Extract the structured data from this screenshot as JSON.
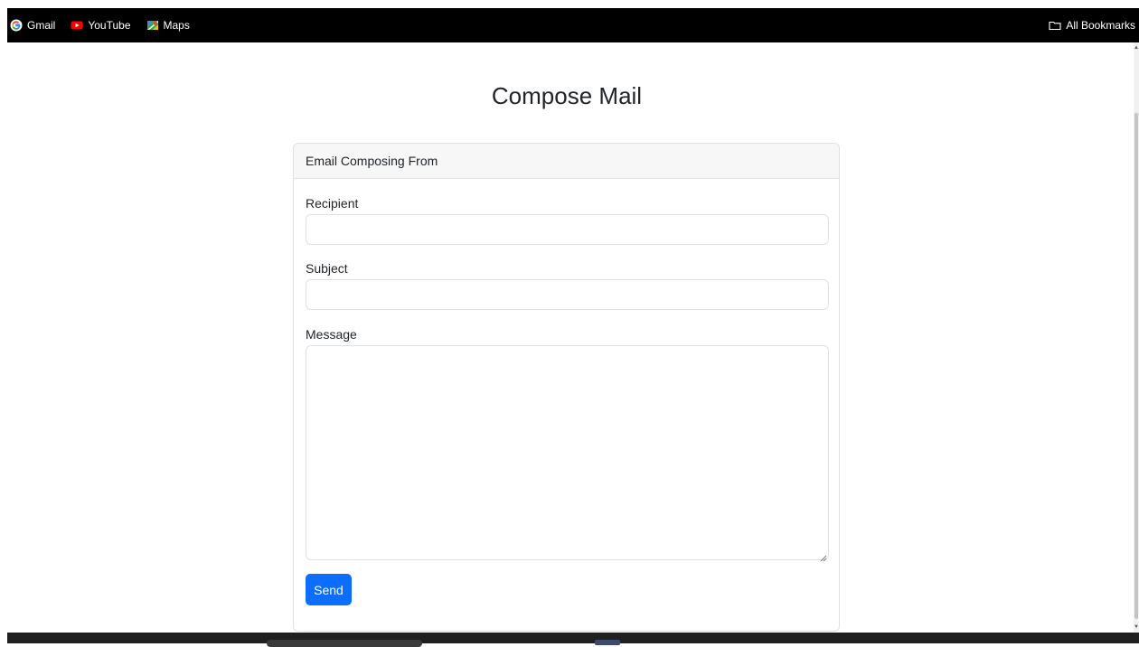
{
  "bookmarks": {
    "items": [
      {
        "label": "Gmail",
        "icon": "google-icon"
      },
      {
        "label": "YouTube",
        "icon": "youtube-icon"
      },
      {
        "label": "Maps",
        "icon": "maps-icon"
      }
    ],
    "all_bookmarks_label": "All Bookmarks",
    "all_bookmarks_icon": "folder-icon"
  },
  "page": {
    "title": "Compose Mail"
  },
  "card": {
    "header": "Email Composing From",
    "recipient_label": "Recipient",
    "recipient_value": "",
    "subject_label": "Subject",
    "subject_value": "",
    "message_label": "Message",
    "message_value": "",
    "send_label": "Send"
  },
  "colors": {
    "accent": "#0d6efd",
    "bookmarks_bar": "#000000",
    "card_header_bg": "#f7f7f7",
    "border": "#dee2e6",
    "text": "#212529"
  }
}
